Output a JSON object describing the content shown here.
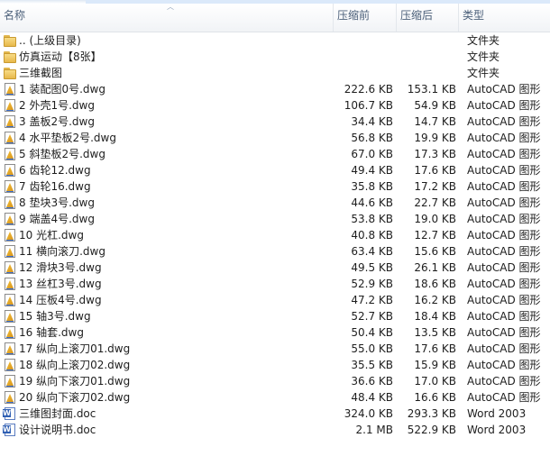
{
  "columns": {
    "name": "名称",
    "before": "压缩前",
    "after": "压缩后",
    "type": "类型"
  },
  "files": [
    {
      "name": ".. (上级目录)",
      "before": "",
      "after": "",
      "type": "文件夹",
      "icon": "folder-icon"
    },
    {
      "name": "仿真运动【8张】",
      "before": "",
      "after": "",
      "type": "文件夹",
      "icon": "folder-icon"
    },
    {
      "name": "三维截图",
      "before": "",
      "after": "",
      "type": "文件夹",
      "icon": "folder-icon"
    },
    {
      "name": "1 装配图0号.dwg",
      "before": "222.6 KB",
      "after": "153.1 KB",
      "type": "AutoCAD 图形",
      "icon": "dwg-file-icon"
    },
    {
      "name": "2 外壳1号.dwg",
      "before": "106.7 KB",
      "after": "54.9 KB",
      "type": "AutoCAD 图形",
      "icon": "dwg-file-icon"
    },
    {
      "name": "3 盖板2号.dwg",
      "before": "34.4 KB",
      "after": "14.7 KB",
      "type": "AutoCAD 图形",
      "icon": "dwg-file-icon"
    },
    {
      "name": "4 水平垫板2号.dwg",
      "before": "56.8 KB",
      "after": "19.9 KB",
      "type": "AutoCAD 图形",
      "icon": "dwg-file-icon"
    },
    {
      "name": "5 斜垫板2号.dwg",
      "before": "67.0 KB",
      "after": "17.3 KB",
      "type": "AutoCAD 图形",
      "icon": "dwg-file-icon"
    },
    {
      "name": "6 齿轮12.dwg",
      "before": "49.4 KB",
      "after": "17.6 KB",
      "type": "AutoCAD 图形",
      "icon": "dwg-file-icon"
    },
    {
      "name": "7 齿轮16.dwg",
      "before": "35.8 KB",
      "after": "17.2 KB",
      "type": "AutoCAD 图形",
      "icon": "dwg-file-icon"
    },
    {
      "name": "8 垫块3号.dwg",
      "before": "44.6 KB",
      "after": "22.7 KB",
      "type": "AutoCAD 图形",
      "icon": "dwg-file-icon"
    },
    {
      "name": "9 端盖4号.dwg",
      "before": "53.8 KB",
      "after": "19.0 KB",
      "type": "AutoCAD 图形",
      "icon": "dwg-file-icon"
    },
    {
      "name": "10 光杠.dwg",
      "before": "40.8 KB",
      "after": "12.7 KB",
      "type": "AutoCAD 图形",
      "icon": "dwg-file-icon"
    },
    {
      "name": "11 横向滚刀.dwg",
      "before": "63.4 KB",
      "after": "15.6 KB",
      "type": "AutoCAD 图形",
      "icon": "dwg-file-icon"
    },
    {
      "name": "12 滑块3号.dwg",
      "before": "49.5 KB",
      "after": "26.1 KB",
      "type": "AutoCAD 图形",
      "icon": "dwg-file-icon"
    },
    {
      "name": "13 丝杠3号.dwg",
      "before": "52.9 KB",
      "after": "18.6 KB",
      "type": "AutoCAD 图形",
      "icon": "dwg-file-icon"
    },
    {
      "name": "14 压板4号.dwg",
      "before": "47.2 KB",
      "after": "16.2 KB",
      "type": "AutoCAD 图形",
      "icon": "dwg-file-icon"
    },
    {
      "name": "15 轴3号.dwg",
      "before": "52.7 KB",
      "after": "18.4 KB",
      "type": "AutoCAD 图形",
      "icon": "dwg-file-icon"
    },
    {
      "name": "16 轴套.dwg",
      "before": "50.4 KB",
      "after": "13.5 KB",
      "type": "AutoCAD 图形",
      "icon": "dwg-file-icon"
    },
    {
      "name": "17 纵向上滚刀01.dwg",
      "before": "55.0 KB",
      "after": "17.6 KB",
      "type": "AutoCAD 图形",
      "icon": "dwg-file-icon"
    },
    {
      "name": "18 纵向上滚刀02.dwg",
      "before": "35.5 KB",
      "after": "15.9 KB",
      "type": "AutoCAD 图形",
      "icon": "dwg-file-icon"
    },
    {
      "name": "19 纵向下滚刀01.dwg",
      "before": "36.6 KB",
      "after": "17.0 KB",
      "type": "AutoCAD 图形",
      "icon": "dwg-file-icon"
    },
    {
      "name": "20 纵向下滚刀02.dwg",
      "before": "48.4 KB",
      "after": "16.6 KB",
      "type": "AutoCAD 图形",
      "icon": "dwg-file-icon"
    },
    {
      "name": "三维图封面.doc",
      "before": "324.0 KB",
      "after": "293.3 KB",
      "type": "Word 2003",
      "icon": "word-doc-icon"
    },
    {
      "name": "设计说明书.doc",
      "before": "2.1 MB",
      "after": "522.9 KB",
      "type": "Word 2003",
      "icon": "word-doc-icon"
    }
  ]
}
